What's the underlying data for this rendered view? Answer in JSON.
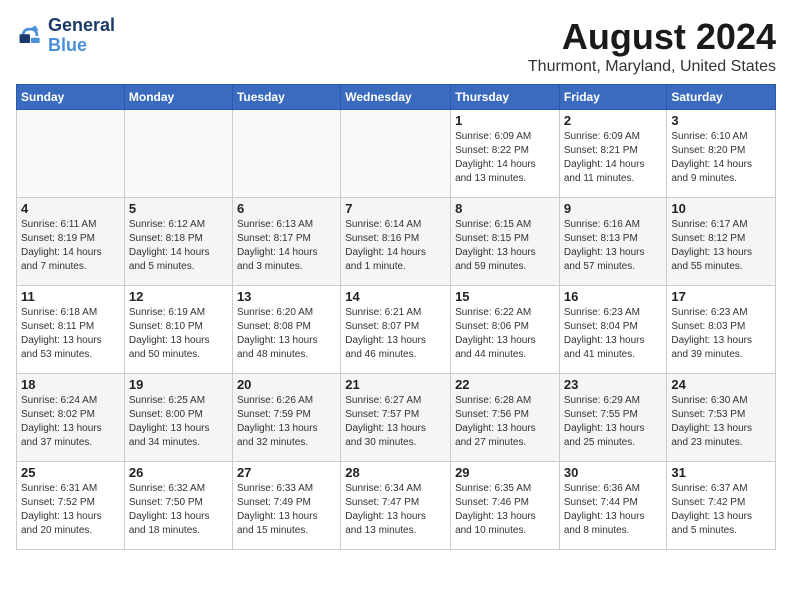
{
  "logo": {
    "line1": "General",
    "line2": "Blue"
  },
  "title": "August 2024",
  "subtitle": "Thurmont, Maryland, United States",
  "weekdays": [
    "Sunday",
    "Monday",
    "Tuesday",
    "Wednesday",
    "Thursday",
    "Friday",
    "Saturday"
  ],
  "weeks": [
    [
      {
        "day": "",
        "info": ""
      },
      {
        "day": "",
        "info": ""
      },
      {
        "day": "",
        "info": ""
      },
      {
        "day": "",
        "info": ""
      },
      {
        "day": "1",
        "info": "Sunrise: 6:09 AM\nSunset: 8:22 PM\nDaylight: 14 hours\nand 13 minutes."
      },
      {
        "day": "2",
        "info": "Sunrise: 6:09 AM\nSunset: 8:21 PM\nDaylight: 14 hours\nand 11 minutes."
      },
      {
        "day": "3",
        "info": "Sunrise: 6:10 AM\nSunset: 8:20 PM\nDaylight: 14 hours\nand 9 minutes."
      }
    ],
    [
      {
        "day": "4",
        "info": "Sunrise: 6:11 AM\nSunset: 8:19 PM\nDaylight: 14 hours\nand 7 minutes."
      },
      {
        "day": "5",
        "info": "Sunrise: 6:12 AM\nSunset: 8:18 PM\nDaylight: 14 hours\nand 5 minutes."
      },
      {
        "day": "6",
        "info": "Sunrise: 6:13 AM\nSunset: 8:17 PM\nDaylight: 14 hours\nand 3 minutes."
      },
      {
        "day": "7",
        "info": "Sunrise: 6:14 AM\nSunset: 8:16 PM\nDaylight: 14 hours\nand 1 minute."
      },
      {
        "day": "8",
        "info": "Sunrise: 6:15 AM\nSunset: 8:15 PM\nDaylight: 13 hours\nand 59 minutes."
      },
      {
        "day": "9",
        "info": "Sunrise: 6:16 AM\nSunset: 8:13 PM\nDaylight: 13 hours\nand 57 minutes."
      },
      {
        "day": "10",
        "info": "Sunrise: 6:17 AM\nSunset: 8:12 PM\nDaylight: 13 hours\nand 55 minutes."
      }
    ],
    [
      {
        "day": "11",
        "info": "Sunrise: 6:18 AM\nSunset: 8:11 PM\nDaylight: 13 hours\nand 53 minutes."
      },
      {
        "day": "12",
        "info": "Sunrise: 6:19 AM\nSunset: 8:10 PM\nDaylight: 13 hours\nand 50 minutes."
      },
      {
        "day": "13",
        "info": "Sunrise: 6:20 AM\nSunset: 8:08 PM\nDaylight: 13 hours\nand 48 minutes."
      },
      {
        "day": "14",
        "info": "Sunrise: 6:21 AM\nSunset: 8:07 PM\nDaylight: 13 hours\nand 46 minutes."
      },
      {
        "day": "15",
        "info": "Sunrise: 6:22 AM\nSunset: 8:06 PM\nDaylight: 13 hours\nand 44 minutes."
      },
      {
        "day": "16",
        "info": "Sunrise: 6:23 AM\nSunset: 8:04 PM\nDaylight: 13 hours\nand 41 minutes."
      },
      {
        "day": "17",
        "info": "Sunrise: 6:23 AM\nSunset: 8:03 PM\nDaylight: 13 hours\nand 39 minutes."
      }
    ],
    [
      {
        "day": "18",
        "info": "Sunrise: 6:24 AM\nSunset: 8:02 PM\nDaylight: 13 hours\nand 37 minutes."
      },
      {
        "day": "19",
        "info": "Sunrise: 6:25 AM\nSunset: 8:00 PM\nDaylight: 13 hours\nand 34 minutes."
      },
      {
        "day": "20",
        "info": "Sunrise: 6:26 AM\nSunset: 7:59 PM\nDaylight: 13 hours\nand 32 minutes."
      },
      {
        "day": "21",
        "info": "Sunrise: 6:27 AM\nSunset: 7:57 PM\nDaylight: 13 hours\nand 30 minutes."
      },
      {
        "day": "22",
        "info": "Sunrise: 6:28 AM\nSunset: 7:56 PM\nDaylight: 13 hours\nand 27 minutes."
      },
      {
        "day": "23",
        "info": "Sunrise: 6:29 AM\nSunset: 7:55 PM\nDaylight: 13 hours\nand 25 minutes."
      },
      {
        "day": "24",
        "info": "Sunrise: 6:30 AM\nSunset: 7:53 PM\nDaylight: 13 hours\nand 23 minutes."
      }
    ],
    [
      {
        "day": "25",
        "info": "Sunrise: 6:31 AM\nSunset: 7:52 PM\nDaylight: 13 hours\nand 20 minutes."
      },
      {
        "day": "26",
        "info": "Sunrise: 6:32 AM\nSunset: 7:50 PM\nDaylight: 13 hours\nand 18 minutes."
      },
      {
        "day": "27",
        "info": "Sunrise: 6:33 AM\nSunset: 7:49 PM\nDaylight: 13 hours\nand 15 minutes."
      },
      {
        "day": "28",
        "info": "Sunrise: 6:34 AM\nSunset: 7:47 PM\nDaylight: 13 hours\nand 13 minutes."
      },
      {
        "day": "29",
        "info": "Sunrise: 6:35 AM\nSunset: 7:46 PM\nDaylight: 13 hours\nand 10 minutes."
      },
      {
        "day": "30",
        "info": "Sunrise: 6:36 AM\nSunset: 7:44 PM\nDaylight: 13 hours\nand 8 minutes."
      },
      {
        "day": "31",
        "info": "Sunrise: 6:37 AM\nSunset: 7:42 PM\nDaylight: 13 hours\nand 5 minutes."
      }
    ]
  ]
}
